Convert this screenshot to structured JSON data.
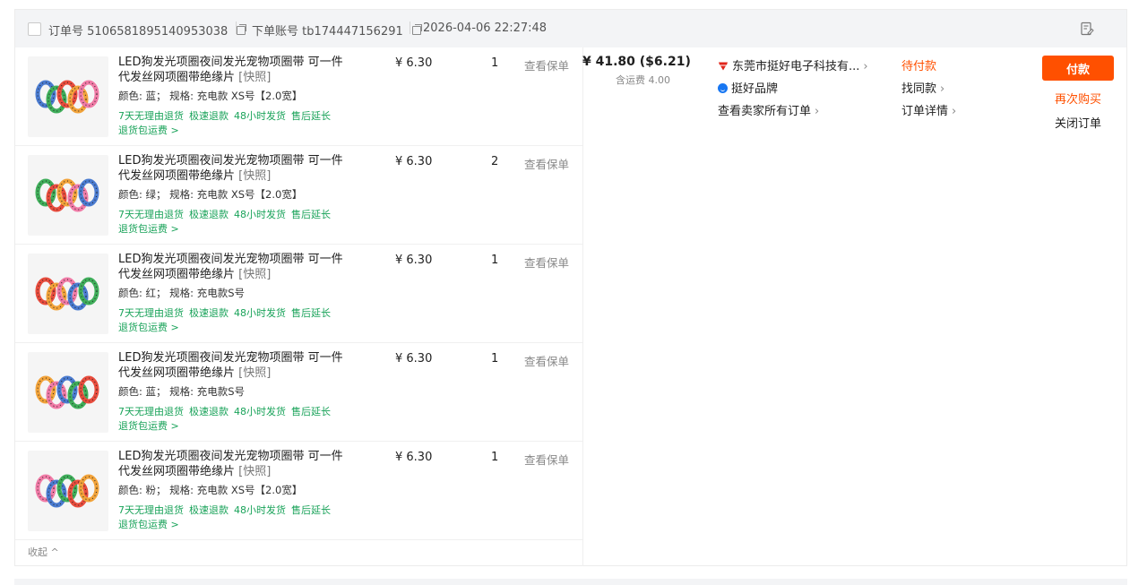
{
  "header": {
    "order_no_label": "订单号",
    "order_no": "5106581895140953038",
    "account_label": "下单账号",
    "account": "tb174447156291",
    "datetime": "2026-04-06 22:27:48"
  },
  "items": [
    {
      "title": "LED狗发光项圈夜间发光宠物项圈带 可一件代发丝网项圈带绝缘片",
      "snapshot": "[快照]",
      "spec": "颜色: 蓝；  规格: 充电款 XS号【2.0宽】",
      "price": "¥ 6.30",
      "qty": "1",
      "insurance": "查看保单"
    },
    {
      "title": "LED狗发光项圈夜间发光宠物项圈带 可一件代发丝网项圈带绝缘片",
      "snapshot": "[快照]",
      "spec": "颜色: 绿；  规格: 充电款 XS号【2.0宽】",
      "price": "¥ 6.30",
      "qty": "2",
      "insurance": "查看保单"
    },
    {
      "title": "LED狗发光项圈夜间发光宠物项圈带 可一件代发丝网项圈带绝缘片",
      "snapshot": "[快照]",
      "spec": "颜色: 红；  规格: 充电款S号",
      "price": "¥ 6.30",
      "qty": "1",
      "insurance": "查看保单"
    },
    {
      "title": "LED狗发光项圈夜间发光宠物项圈带 可一件代发丝网项圈带绝缘片",
      "snapshot": "[快照]",
      "spec": "颜色: 蓝；  规格: 充电款S号",
      "price": "¥ 6.30",
      "qty": "1",
      "insurance": "查看保单"
    },
    {
      "title": "LED狗发光项圈夜间发光宠物项圈带 可一件代发丝网项圈带绝缘片",
      "snapshot": "[快照]",
      "spec": "颜色: 粉；  规格: 充电款 XS号【2.0宽】",
      "price": "¥ 6.30",
      "qty": "1",
      "insurance": "查看保单"
    }
  ],
  "services": [
    "7天无理由退货",
    "极速退款",
    "48小时发货",
    "售后延长"
  ],
  "shipping_service": "退货包运费 >",
  "collapse_label": "收起 ^",
  "summary": {
    "total": "¥ 41.80 ($6.21)",
    "shipping_fee": "含运费 4.00"
  },
  "seller": {
    "name": "东莞市挺好电子科技有...",
    "brand": "挺好品牌",
    "all_orders": "查看卖家所有订单"
  },
  "status": {
    "label": "待付款",
    "find_similar": "找同款",
    "order_detail": "订单详情"
  },
  "actions": {
    "pay": "付款",
    "rebuy": "再次购买",
    "close": "关闭订单"
  },
  "colors": {
    "accent": "#ff5000",
    "service_green": "#1aa35a",
    "header_bg": "#f3f4f6"
  },
  "icons": {
    "shop": "shop-icon",
    "brand": "brand-icon",
    "note": "note-edit-icon",
    "copy": "copy-icon"
  }
}
